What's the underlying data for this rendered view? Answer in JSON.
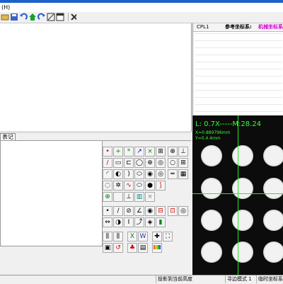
{
  "menubar": {
    "label": "(H)"
  },
  "toolbar": {
    "icons": [
      "folder-icon",
      "save-icon",
      "undo-icon",
      "home-icon",
      "redo-icon",
      "expand-icon",
      "window-icon",
      "tools-icon"
    ]
  },
  "record_tab": {
    "label": "表记录"
  },
  "coord_panel": {
    "system_label": "CPL1",
    "reference_label": "参考坐标系:",
    "machine_label": "机械坐标系"
  },
  "camera": {
    "zoom": "L: 0.7X",
    "magnification": "M:28.24",
    "x_readout": "X=0.889796mm",
    "y_readout": "Y=0.4.4mm"
  },
  "statusbar": {
    "project_label": "投影到当前高度",
    "guide_mode_label": "寻边模式 1",
    "temp_coord_label": "临时坐标系"
  },
  "colors": {
    "overlay_text": "#33ff33",
    "machine_label": "#cc00cc",
    "window_title": "#1c62c8"
  }
}
